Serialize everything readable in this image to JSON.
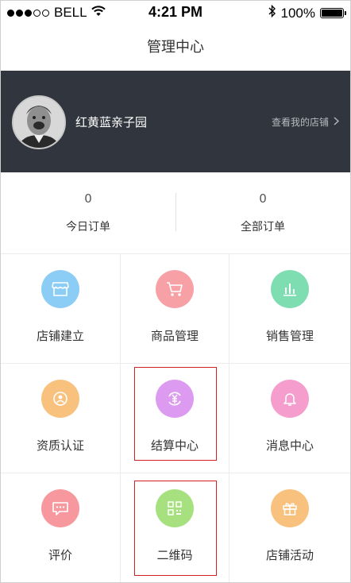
{
  "status_bar": {
    "carrier": "BELL",
    "time": "4:21 PM",
    "battery": "100%"
  },
  "nav": {
    "title": "管理中心"
  },
  "profile": {
    "shop_name": "红黄蓝亲子园",
    "view_shop": "查看我的店铺"
  },
  "orders": {
    "today": {
      "count": "0",
      "label": "今日订单"
    },
    "all": {
      "count": "0",
      "label": "全部订单"
    }
  },
  "menu": [
    {
      "label": "店铺建立",
      "icon": "store-icon",
      "color": "#8ccdf6"
    },
    {
      "label": "商品管理",
      "icon": "cart-icon",
      "color": "#f7a1a7"
    },
    {
      "label": "销售管理",
      "icon": "bar-chart-icon",
      "color": "#7fddb2"
    },
    {
      "label": "资质认证",
      "icon": "certificate-icon",
      "color": "#f8c27e"
    },
    {
      "label": "结算中心",
      "icon": "yuan-settlement-icon",
      "color": "#dc9bf1"
    },
    {
      "label": "消息中心",
      "icon": "bell-icon",
      "color": "#f59dcc"
    },
    {
      "label": "评价",
      "icon": "comment-icon",
      "color": "#f7989e"
    },
    {
      "label": "二维码",
      "icon": "qr-code-icon",
      "color": "#a7e07f"
    },
    {
      "label": "店铺活动",
      "icon": "gift-icon",
      "color": "#f8c27e"
    }
  ]
}
